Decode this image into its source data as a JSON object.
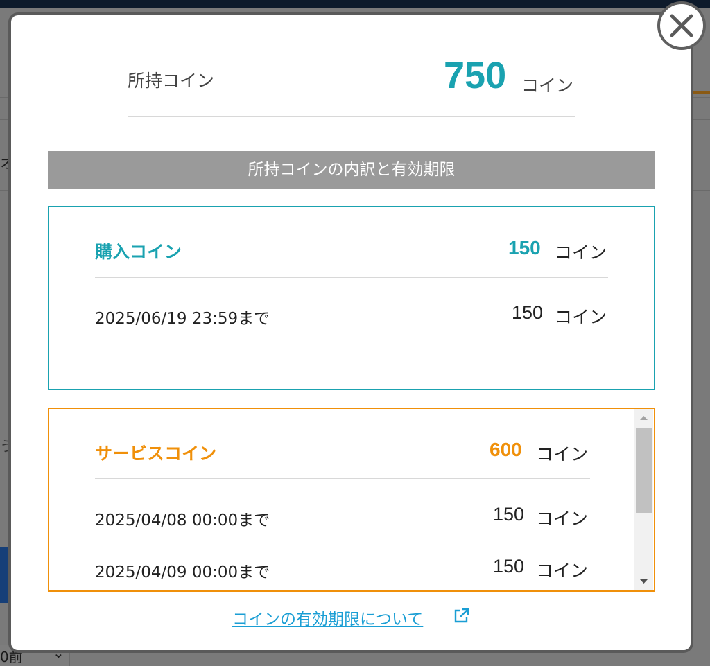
{
  "background": {
    "left_text_1": "オ",
    "left_text_2": "う",
    "select_value": "0前",
    "select_chevron": "⌄"
  },
  "modal": {
    "total": {
      "label": "所持コイン",
      "value": "750",
      "unit": "コイン"
    },
    "breakdown_header": "所持コインの内訳と有効期限",
    "purchase": {
      "title": "購入コイン",
      "amount": "150",
      "unit": "コイン",
      "rows": [
        {
          "date": "2025/06/19 23:59まで",
          "amount": "150",
          "unit": "コイン"
        }
      ]
    },
    "service": {
      "title": "サービスコイン",
      "amount": "600",
      "unit": "コイン",
      "rows": [
        {
          "date": "2025/04/08 00:00まで",
          "amount": "150",
          "unit": "コイン"
        },
        {
          "date": "2025/04/09 00:00まで",
          "amount": "150",
          "unit": "コイン"
        }
      ]
    },
    "expiry_link": "コインの有効期限について",
    "icons": {
      "close": "close-icon",
      "external": "external-link-icon",
      "scroll_up": "scroll-up-arrow-icon",
      "scroll_down": "scroll-down-arrow-icon"
    },
    "colors": {
      "purchase_accent": "#1aa2b0",
      "service_accent": "#f0900a",
      "link": "#1a9ed4",
      "header_bg": "#9a9a9a"
    }
  }
}
